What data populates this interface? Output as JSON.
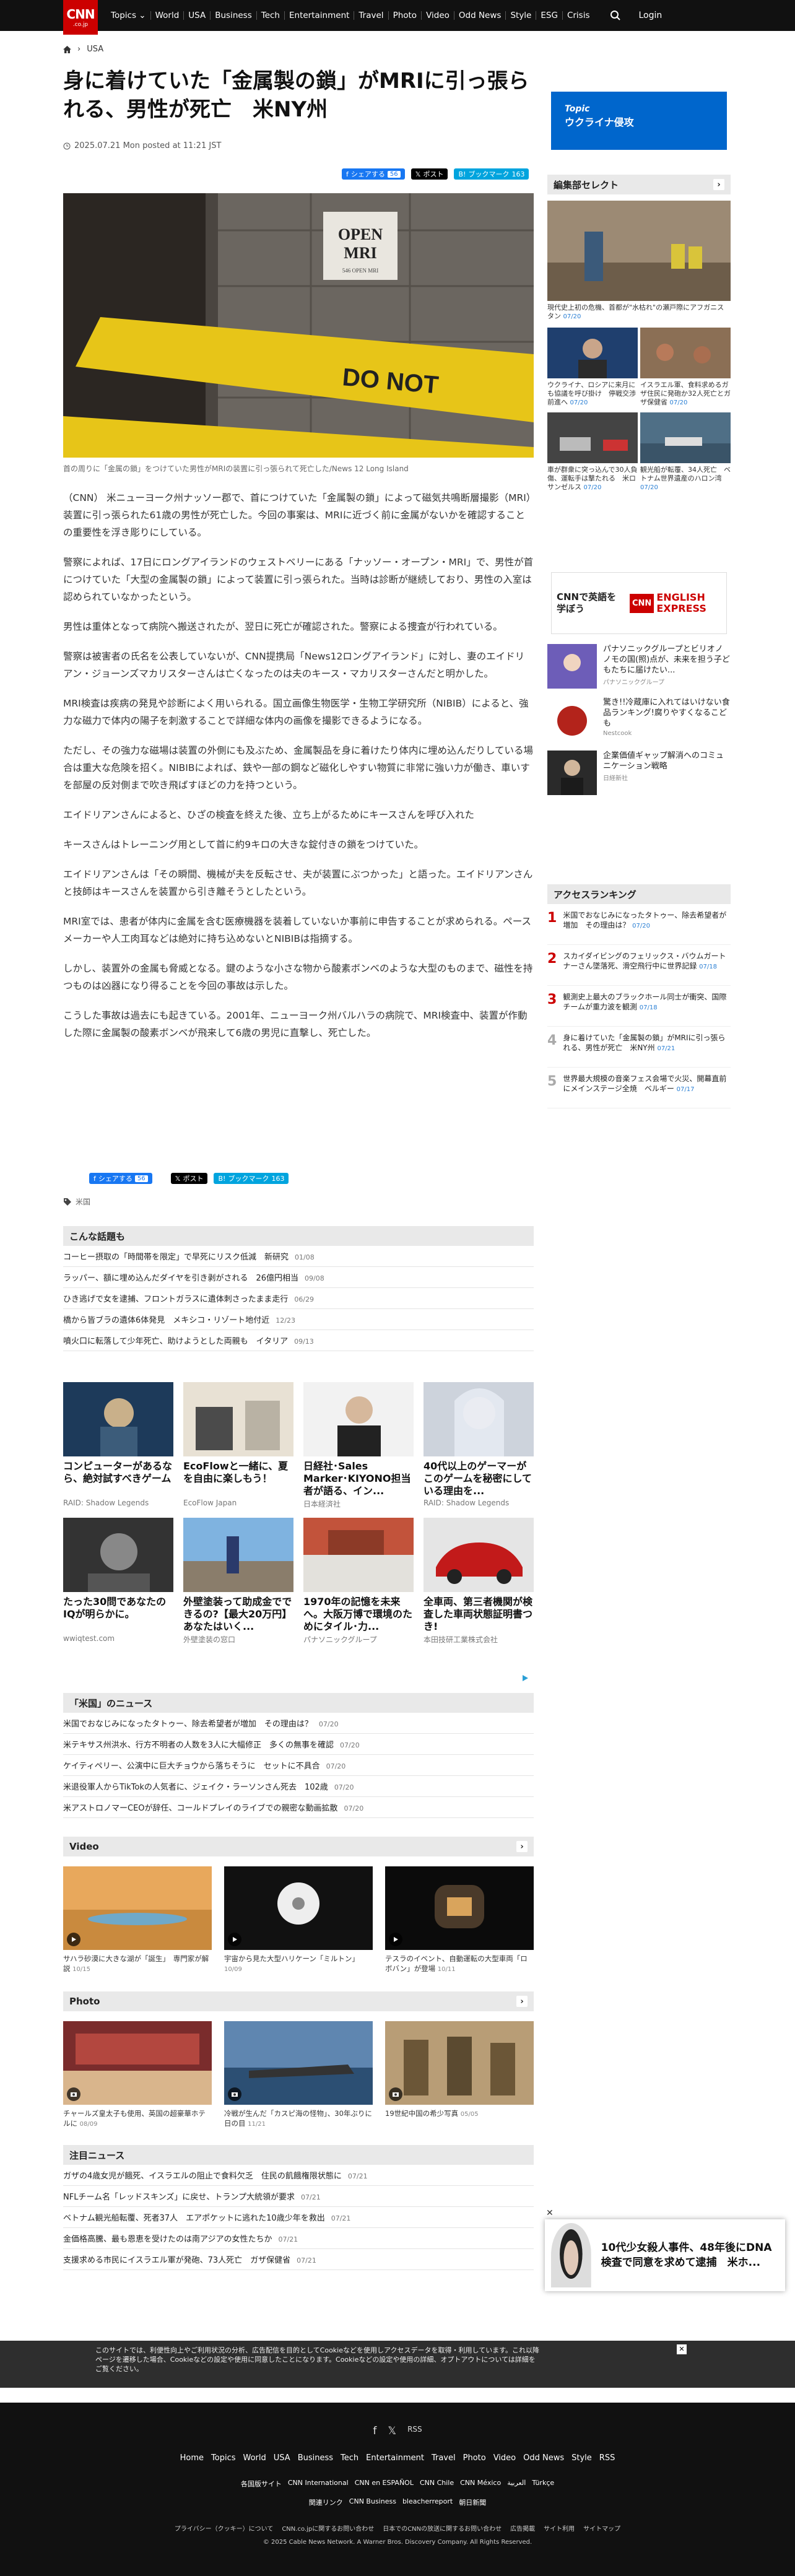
{
  "header": {
    "logo": "CNN",
    "logo_sub": ".co.jp",
    "nav": [
      "Topics ⌄",
      "World",
      "USA",
      "Business",
      "Tech",
      "Entertainment",
      "Travel",
      "Photo",
      "Video",
      "Odd News",
      "Style",
      "ESG",
      "Crisis"
    ],
    "login": "Login"
  },
  "breadcrumb": {
    "section": "USA"
  },
  "article": {
    "headline": "身に着けていた「金属製の鎖」がMRIに引っ張られる、男性が死亡　米NY州",
    "dateline": "2025.07.21 Mon posted at 11:21 JST",
    "share": {
      "facebook": "シェアする",
      "facebook_count": "56",
      "x": "ポスト",
      "hatena": "ブックマーク",
      "hatena_count": "163"
    },
    "caption": "首の周りに「金属の鎖」をつけていた男性がMRIの装置に引っ張られて死亡した/News 12 Long Island",
    "paragraphs": [
      "（CNN） 米ニューヨーク州ナッソー郡で、首につけていた「金属製の鎖」によって磁気共鳴断層撮影（MRI）装置に引っ張られた61歳の男性が死亡した。今回の事案は、MRIに近づく前に金属がないかを確認することの重要性を浮き彫りにしている。",
      "警察によれば、17日にロングアイランドのウェストベリーにある「ナッソー・オープン・MRI」で、男性が首につけていた「大型の金属製の鎖」によって装置に引っ張られた。当時は診断が継続しており、男性の入室は認められていなかったという。",
      "男性は重体となって病院へ搬送されたが、翌日に死亡が確認された。警察による捜査が行われている。",
      "警察は被害者の氏名を公表していないが、CNN提携局「News12ロングアイランド」に対し、妻のエイドリアン・ジョーンズマカリスターさんは亡くなったのは夫のキース・マカリスターさんだと明かした。",
      "MRI検査は疾病の発見や診断によく用いられる。国立画像生物医学・生物工学研究所（NIBIB）によると、強力な磁力で体内の陽子を刺激することで詳細な体内の画像を撮影できるようになる。",
      "ただし、その強力な磁場は装置の外側にも及ぶため、金属製品を身に着けたり体内に埋め込んだりしている場合は重大な危険を招く。NIBIBによれば、鉄や一部の鋼など磁化しやすい物質に非常に強い力が働き、車いすを部屋の反対側まで吹き飛ばすほどの力を持つという。",
      "エイドリアンさんによると、ひざの検査を終えた後、立ち上がるためにキースさんを呼び入れた",
      "キースさんはトレーニング用として首に約9キロの大きな錠付きの鎖をつけていた。",
      "エイドリアンさんは「その瞬間、機械が夫を反転させ、夫が装置にぶつかった」と語った。エイドリアンさんと技師はキースさんを装置から引き離そうとしたという。",
      "MRI室では、患者が体内に金属を含む医療機器を装着していないか事前に申告することが求められる。ペースメーカーや人工肉耳などは絶対に持ち込めないとNIBIBは指摘する。",
      "しかし、装置外の金属も脅威となる。鍵のような小さな物から酸素ボンベのような大型のものまで、磁性を持つものは凶器になり得ることを今回の事故は示した。",
      "こうした事故は過去にも起きている。2001年、ニューヨーク州バルハラの病院で、MRI検査中、装置が作動した際に金属製の酸素ボンベが飛来して6歳の男児に直撃し、死亡した。"
    ],
    "tag": "米国"
  },
  "hot_topics": {
    "title": "こんな話題も",
    "items": [
      {
        "text": "コーヒー摂取の「時間帯を限定」で早死にリスク低減　新研究",
        "date": "01/08"
      },
      {
        "text": "ラッパー、額に埋め込んだダイヤを引き剥がされる　26億円相当",
        "date": "09/08"
      },
      {
        "text": "ひき逃げで女を逮捕、フロントガラスに遺体刺さったまま走行",
        "date": "06/29"
      },
      {
        "text": "橋から皆ブラの遺体6体発見　メキシコ・リゾート地付近",
        "date": "12/23"
      },
      {
        "text": "噴火口に転落して少年死亡、助けようとした両親も　イタリア",
        "date": "09/13"
      }
    ]
  },
  "sponsored": [
    {
      "title": "コンピューターがあるなら、絶対試すべきゲーム",
      "source": "RAID: Shadow Legends"
    },
    {
      "title": "EcoFlowと一緒に、夏を自由に楽しもう！",
      "source": "EcoFlow Japan"
    },
    {
      "title": "日経社･Sales Marker･KIYONO担当者が語る、イン...",
      "source": "日本経済社"
    },
    {
      "title": "40代以上のゲーマーがこのゲームを秘密にしている理由を...",
      "source": "RAID: Shadow Legends"
    },
    {
      "title": "たった30問であなたのIQが明らかに。",
      "source": "wwiqtest.com"
    },
    {
      "title": "外壁塗装って助成金でできるの?【最大20万円】あなたはいく...",
      "source": "外壁塗装の窓口"
    },
    {
      "title": "1970年の記憶を未来へ。大阪万博で環境のためにタイル･力...",
      "source": "パナソニックグループ"
    },
    {
      "title": "全車両、第三者機関が検査した車両状態証明書つき!",
      "source": "本田技研工業株式会社"
    }
  ],
  "us_news": {
    "title": "「米国」のニュース",
    "items": [
      {
        "text": "米国でおなじみになったタトゥー、除去希望者が増加　その理由は？",
        "date": "07/20"
      },
      {
        "text": "米テキサス州洪水、行方不明者の人数を3人に大幅修正　多くの無事を確認",
        "date": "07/20"
      },
      {
        "text": "ケイティペリー、公演中に巨大チョウから落ちそうに　セットに不具合",
        "date": "07/20"
      },
      {
        "text": "米退役軍人からTikTokの人気者に、ジェイク・ラーソンさん死去　102歳",
        "date": "07/20"
      },
      {
        "text": "米アストロノマーCEOが辞任、コールドプレイのライブでの親密な動画拡散",
        "date": "07/20"
      }
    ]
  },
  "video": {
    "title": "Video",
    "items": [
      {
        "text": "サハラ砂漠に大きな湖が「誕生」　専門家が解説",
        "date": "10/15"
      },
      {
        "text": "宇宙から見た大型ハリケーン「ミルトン」",
        "date": "10/09"
      },
      {
        "text": "テスラのイベント、自動運転の大型車両「ロボバン」が登場",
        "date": "10/11"
      }
    ]
  },
  "photo": {
    "title": "Photo",
    "items": [
      {
        "text": "チャールズ皇太子も使用、英国の超豪華ホテルに",
        "date": "08/09"
      },
      {
        "text": "冷戦が生んだ「カスピ海の怪物」、30年ぶりに日の目",
        "date": "11/21"
      },
      {
        "text": "19世紀中国の希少写真",
        "date": "05/05"
      }
    ]
  },
  "notice": {
    "title": "注目ニュース",
    "items": [
      {
        "text": "ガザの4歳女児が餓死、イスラエルの阻止で食料欠乏　住民の飢餓権限状態に",
        "date": "07/21"
      },
      {
        "text": "NFLチーム名「レッドスキンズ」に戻せ、トランプ大統領が要求",
        "date": "07/21"
      },
      {
        "text": "ベトナム観光船転覆、死者37人　エアポケットに逃れた10歳少年を救出",
        "date": "07/21"
      },
      {
        "text": "金価格高騰、最も恩恵を受けたのは南アジアの女性たちか",
        "date": "07/21"
      },
      {
        "text": "支援求める市民にイスラエル軍が発砲、73人死亡　ガザ保健省",
        "date": "07/21"
      }
    ]
  },
  "sidebar": {
    "topic_kicker": "Topic",
    "topic_title": "ウクライナ侵攻",
    "editor_title": "編集部セレクト",
    "editor_big": {
      "text": "現代史上初の危機、首都が\"水枯れ\"の瀬戸際にアフガニスタン",
      "date": "07/20"
    },
    "editor_items": [
      {
        "text": "ウクライナ、ロシアに来月にも協議を呼び掛け　停戦交渉前進へ",
        "date": "07/20"
      },
      {
        "text": "イスラエル軍、食料求めるガザ住民に発砲か32人死亡とガザ保健省",
        "date": "07/20"
      },
      {
        "text": "車が群衆に突っ込んで30人負傷、運転手は撃たれる　米ロサンゼルス",
        "date": "07/20"
      },
      {
        "text": "観光船が転覆、34人死亡　ベトナム世界遺産のハロン湾",
        "date": "07/20"
      }
    ],
    "banner_text": "CNNで英語を学ぼう",
    "banner_logo_top": "CNN",
    "banner_logo_a": "ENGLISH",
    "banner_logo_b": "EXPRESS",
    "promos": [
      {
        "text": "パナソニックグループとビリオノノモの国(照)点が、未来を担う子どもたちに届けたい...",
        "source": "パナソニックグループ"
      },
      {
        "text": "驚き!!冷蔵庫に入れてはいけない食品ランキング!腐りやすくなるこども",
        "source": "Nestcook"
      },
      {
        "text": "企業価値ギャップ解消へのコミュニケーション戦略",
        "source": "日経新社"
      }
    ],
    "ranking_title": "アクセスランキング",
    "ranking": [
      {
        "rank": "1",
        "text": "米国でおなじみになったタトゥー、除去希望者が増加　その理由は？",
        "date": "07/20"
      },
      {
        "rank": "2",
        "text": "スカイダイビングのフェリックス・バウムガートナーさん墜落死、滑空飛行中に世界記録",
        "date": "07/18"
      },
      {
        "rank": "3",
        "text": "観測史上最大のブラックホール同士が衝突、国際チームが重力波を観測",
        "date": "07/18"
      },
      {
        "rank": "4",
        "text": "身に着けていた「金属製の鎖」がMRIに引っ張られる、男性が死亡　米NY州",
        "date": "07/21"
      },
      {
        "rank": "5",
        "text": "世界最大規模の音楽フェス会場で火災、開幕直前にメインステージ全焼　ベルギー",
        "date": "07/17"
      }
    ]
  },
  "float_ad": {
    "text": "10代少女殺人事件、48年後にDNA検査で同意を求めて逮捕　米ホ..."
  },
  "cookie": {
    "text": "このサイトでは、利便性向上やご利用状況の分析、広告配信を目的としてCookieなどを使用しアクセスデータを取得・利用しています。これ以降ページを遷移した場合、Cookieなどの設定や使用に同意したことになります。Cookieなどの設定や使用の詳細、オプトアウトについては詳細をご覧ください。",
    "close": "✕"
  },
  "footer": {
    "social": [
      "f",
      "𝕏",
      "RSS"
    ],
    "nav": [
      "Home",
      "Topics",
      "World",
      "USA",
      "Business",
      "Tech",
      "Entertainment",
      "Travel",
      "Photo",
      "Video",
      "Odd News",
      "Style",
      "RSS"
    ],
    "editions": [
      "各国版サイト",
      "CNN International",
      "CNN en ESPAÑOL",
      "CNN Chile",
      "CNN México",
      "العربية",
      "Türkçe"
    ],
    "related": [
      "関連リンク",
      "CNN Business",
      "bleacherreport",
      "朝日新聞"
    ],
    "legal": [
      "プライバシー（クッキー）について",
      "CNN.co.jpに関するお問い合わせ",
      "日本でのCNNの放送に関するお問い合わせ",
      "広告掲載",
      "サイト利用",
      "サイトマップ"
    ],
    "copyright": "© 2025 Cable News Network. A Warner Bros. Discovery Company. All Rights Reserved."
  }
}
